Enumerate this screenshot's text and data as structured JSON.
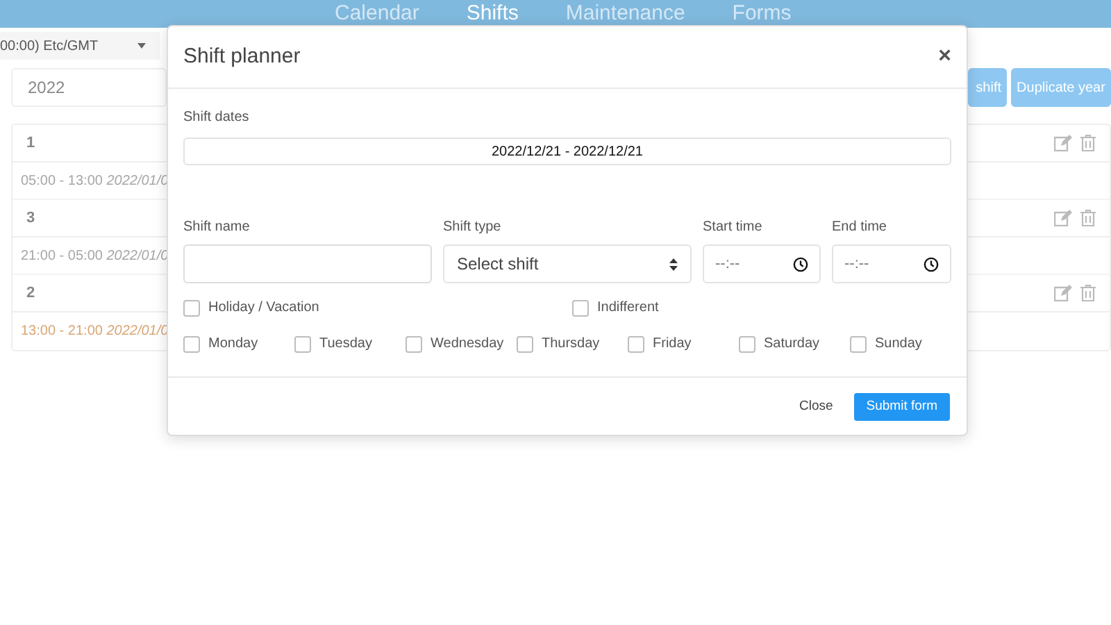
{
  "nav": {
    "tabs": [
      {
        "label": "Calendar",
        "selected": false
      },
      {
        "label": "Shifts",
        "selected": true
      },
      {
        "label": "Maintenance",
        "selected": false
      },
      {
        "label": "Forms",
        "selected": false
      }
    ]
  },
  "timezone": {
    "value": "00:00) Etc/GMT"
  },
  "year": {
    "value": "2022"
  },
  "buttons": [
    {
      "label": "shift"
    },
    {
      "label": "Duplicate year"
    }
  ],
  "shifts": [
    {
      "name": "1",
      "time": "05:00 - 13:00",
      "date": "2022/01/0",
      "color": "#a6a6a6"
    },
    {
      "name": "3",
      "time": "21:00 - 05:00",
      "date": "2022/01/0",
      "color": "#a6a6a6"
    },
    {
      "name": "2",
      "time": "13:00 - 21:00",
      "date": "2022/01/0",
      "color": "#d9a574"
    }
  ],
  "modal": {
    "title": "Shift planner",
    "close": "×",
    "dates": {
      "label": "Shift dates",
      "value": "2022/12/21 - 2022/12/21"
    },
    "name": {
      "label": "Shift name"
    },
    "type": {
      "label": "Shift type",
      "placeholder": "Select shift"
    },
    "start": {
      "label": "Start time",
      "placeholder": "--:--"
    },
    "end": {
      "label": "End time",
      "placeholder": "--:--"
    },
    "options": [
      {
        "label": "Holiday / Vacation",
        "checked": false
      },
      {
        "label": "Indifferent",
        "checked": false
      }
    ],
    "days": [
      {
        "label": "Monday",
        "checked": false
      },
      {
        "label": "Tuesday",
        "checked": false
      },
      {
        "label": "Wednesday",
        "checked": false
      },
      {
        "label": "Thursday",
        "checked": false
      },
      {
        "label": "Friday",
        "checked": false
      },
      {
        "label": "Saturday",
        "checked": false
      },
      {
        "label": "Sunday",
        "checked": false
      }
    ],
    "footer": [
      {
        "label": "Close",
        "kind": "plain"
      },
      {
        "label": "Submit form",
        "kind": "primary"
      }
    ]
  }
}
